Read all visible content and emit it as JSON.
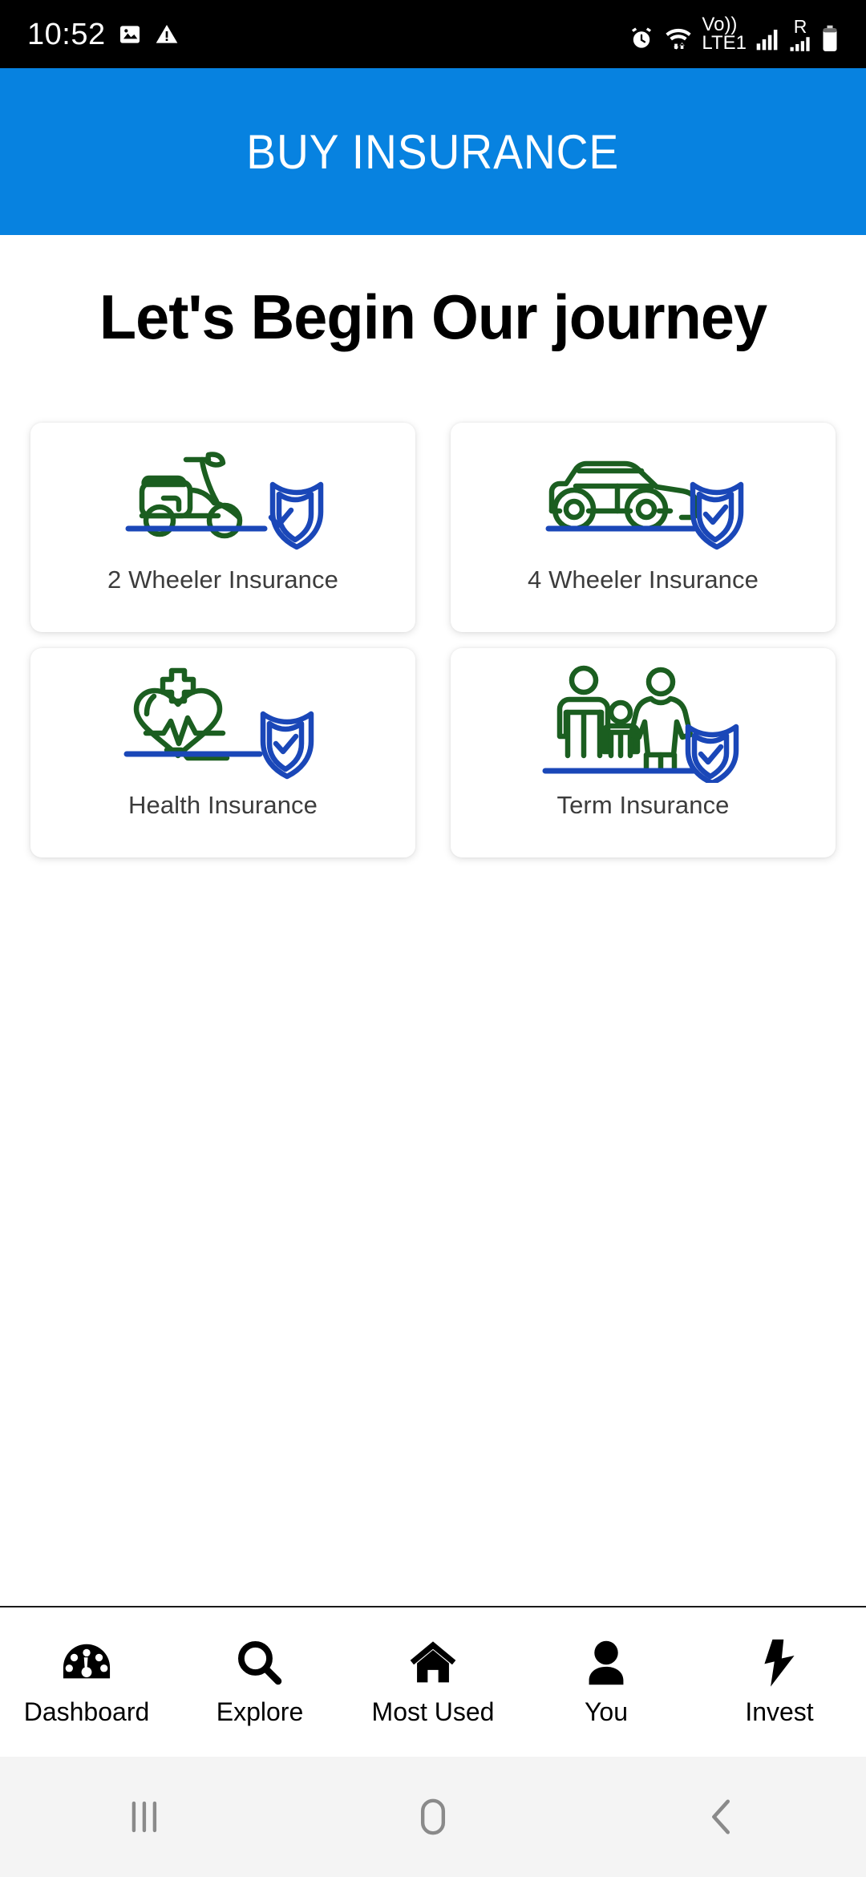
{
  "status_bar": {
    "time": "10:52",
    "left_icons": [
      "image-icon",
      "warning-triangle-icon"
    ],
    "right_icons": [
      "alarm-clock-icon",
      "wifi-icon",
      "volte1-icon",
      "signal-bars-icon",
      "roaming-signal-icon",
      "battery-icon"
    ],
    "network_label": "Vo))",
    "network_sub_label": "LTE1",
    "roaming_label": "R",
    "background_color": "#000000",
    "foreground_color": "#FFFFFF"
  },
  "app_bar": {
    "title": "BUY INSURANCE",
    "background_color": "#0782E0",
    "text_color": "#FFFFFF"
  },
  "page": {
    "heading": "Let's Begin Our journey",
    "background_color": "#FFFFFF"
  },
  "colors": {
    "accent_blue": "#0782E0",
    "icon_green": "#1B5E20",
    "icon_blue": "#1A47B8",
    "card_bg": "#FFFFFF",
    "label_text": "#3C3C3C"
  },
  "insurance_cards": [
    {
      "id": "two-wheeler",
      "label": "2 Wheeler Insurance",
      "icon": "scooter-shield-icon"
    },
    {
      "id": "four-wheeler",
      "label": "4 Wheeler Insurance",
      "icon": "car-shield-icon"
    },
    {
      "id": "health",
      "label": "Health Insurance",
      "icon": "heart-cross-shield-icon"
    },
    {
      "id": "term",
      "label": "Term Insurance",
      "icon": "family-shield-icon"
    }
  ],
  "bottom_nav": {
    "items": [
      {
        "label": "Dashboard",
        "icon": "speedometer-icon"
      },
      {
        "label": "Explore",
        "icon": "search-icon"
      },
      {
        "label": "Most Used",
        "icon": "home-icon"
      },
      {
        "label": "You",
        "icon": "person-icon"
      },
      {
        "label": "Invest",
        "icon": "lightning-bolt-icon"
      }
    ]
  },
  "system_nav": {
    "buttons": [
      {
        "name": "recents",
        "icon": "recents-bars-icon"
      },
      {
        "name": "home",
        "icon": "home-pill-icon"
      },
      {
        "name": "back",
        "icon": "back-chevron-icon"
      }
    ],
    "background_color": "#F4F4F4",
    "icon_color": "#8A8A8A"
  }
}
